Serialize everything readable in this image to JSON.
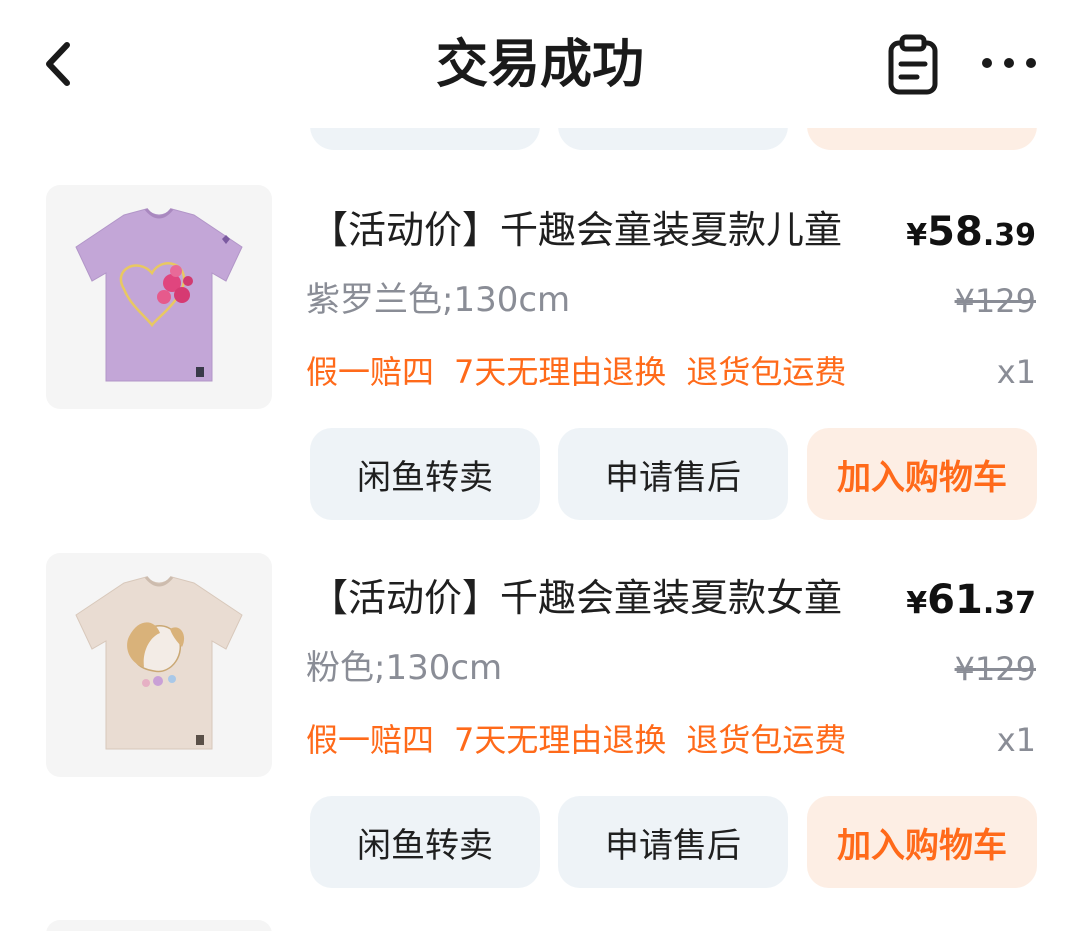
{
  "header": {
    "title": "交易成功",
    "back_icon": "chevron-left-icon",
    "order_icon": "clipboard-icon",
    "more_icon": "more-dots-icon"
  },
  "colors": {
    "accent": "#ff6a1a",
    "muted": "#8a8d96",
    "button_grey": "#eef3f7",
    "button_orange_bg": "#fdeee4"
  },
  "items": [
    {
      "title": "【活动价】千趣会童装夏款儿童",
      "price_currency": "¥",
      "price_int": "58",
      "price_dec": ".39",
      "variant": "紫罗兰色;130cm",
      "original_price": "¥129",
      "tags": [
        "假一赔四",
        "7天无理由退换",
        "退货包运费"
      ],
      "quantity": "x1",
      "buttons": [
        "闲鱼转卖",
        "申请售后",
        "加入购物车"
      ]
    },
    {
      "title": "【活动价】千趣会童装夏款女童",
      "price_currency": "¥",
      "price_int": "61",
      "price_dec": ".37",
      "variant": "粉色;130cm",
      "original_price": "¥129",
      "tags": [
        "假一赔四",
        "7天无理由退换",
        "退货包运费"
      ],
      "quantity": "x1",
      "buttons": [
        "闲鱼转卖",
        "申请售后",
        "加入购物车"
      ]
    }
  ]
}
